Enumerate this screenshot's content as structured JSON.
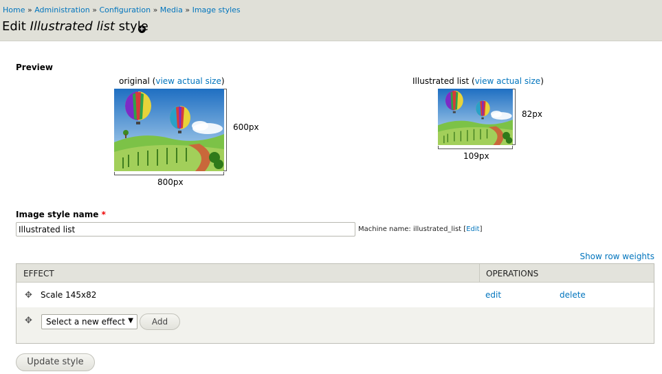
{
  "breadcrumb": {
    "items": [
      "Home",
      "Administration",
      "Configuration",
      "Media",
      "Image styles"
    ],
    "separator": "»"
  },
  "page": {
    "title_prefix": "Edit ",
    "title_name": "Illustrated list",
    "title_suffix": " style"
  },
  "preview": {
    "label": "Preview",
    "original": {
      "caption_prefix": "original (",
      "link": "view actual size",
      "caption_suffix": ")",
      "width_label": "800px",
      "height_label": "600px"
    },
    "derivative": {
      "caption_prefix": "Illustrated list (",
      "link": "view actual size",
      "caption_suffix": ")",
      "width_label": "109px",
      "height_label": "82px"
    }
  },
  "form": {
    "name_label": "Image style name",
    "required_mark": "*",
    "name_value": "Illustrated list",
    "machine_name_prefix": "Machine name: illustrated_list [",
    "machine_name_edit": "Edit",
    "machine_name_suffix": "]"
  },
  "table": {
    "show_row_weights": "Show row weights",
    "headers": [
      "Effect",
      "Operations"
    ],
    "rows": [
      {
        "effect": "Scale 145x82",
        "edit": "edit",
        "delete": "delete"
      }
    ],
    "new_effect_placeholder": "Select a new effect",
    "add_label": "Add"
  },
  "actions": {
    "update_label": "Update style"
  },
  "colors": {
    "header_bg": "#e0e0d8",
    "link": "#0074bd",
    "required": "#e00000"
  }
}
